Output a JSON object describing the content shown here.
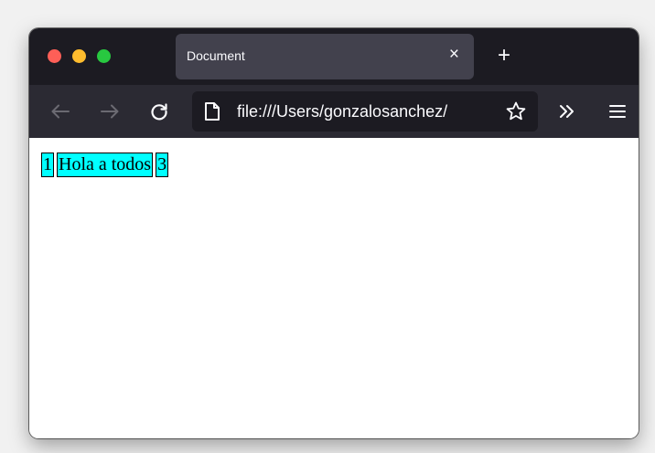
{
  "browser": {
    "tab": {
      "title": "Document",
      "close_glyph": "×"
    },
    "new_tab_glyph": "+",
    "address_bar": {
      "url": "file:///Users/gonzalosanchez/"
    },
    "icons": [
      "back-arrow-icon",
      "forward-arrow-icon",
      "reload-icon",
      "page-icon",
      "bookmark-star-icon",
      "overflow-chevrons-icon",
      "hamburger-menu-icon"
    ]
  },
  "page": {
    "items": [
      "1",
      "Hola a todos",
      "3"
    ],
    "item_background": "#00ffff",
    "item_border": "#000000"
  },
  "colors": {
    "titlebar": "#1c1b22",
    "tab_active": "#42414d",
    "navbar": "#2b2a33",
    "traffic_red": "#fe5f57",
    "traffic_yellow": "#febc2e",
    "traffic_green": "#28c840"
  }
}
